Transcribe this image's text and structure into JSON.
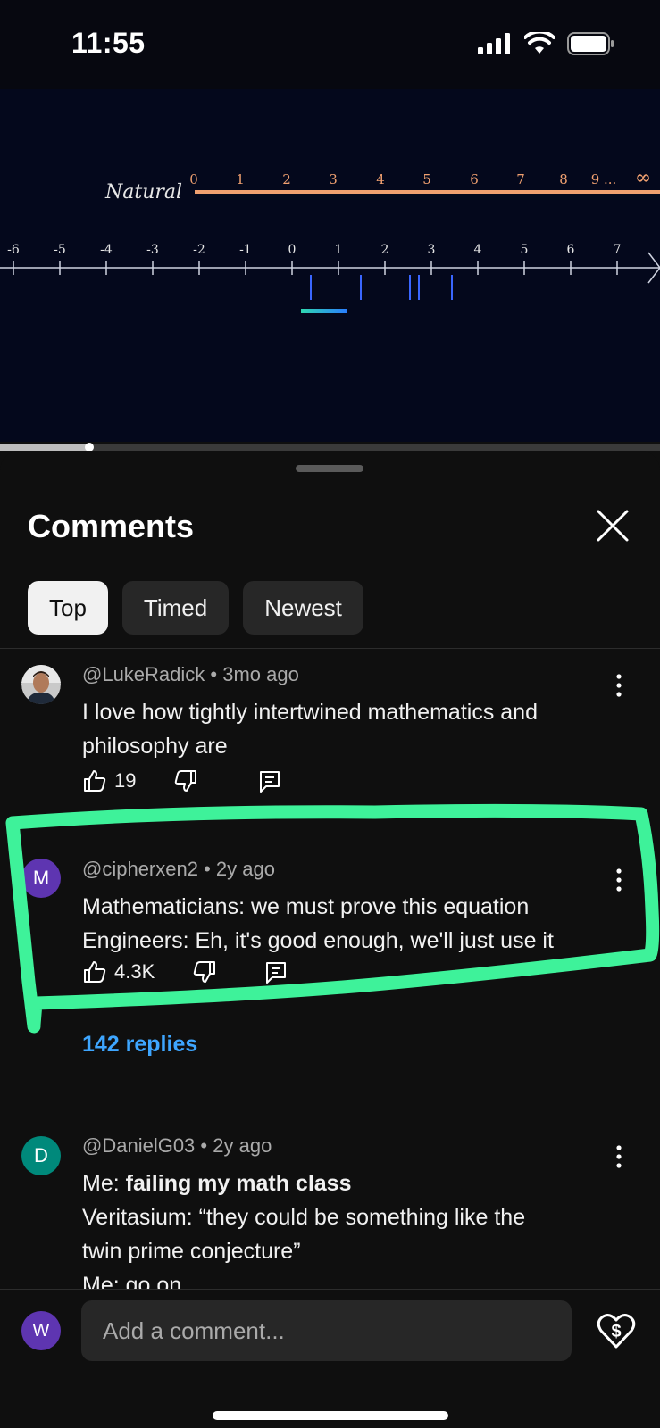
{
  "status_bar": {
    "time": "11:55",
    "icons": [
      "cellular-signal-icon",
      "wifi-icon",
      "battery-icon"
    ]
  },
  "video": {
    "natural_label": "Natural",
    "natural_ticks": [
      "0",
      "1",
      "2",
      "3",
      "4",
      "5",
      "6",
      "7",
      "8",
      "9 ...",
      "∞"
    ],
    "number_line_ticks": [
      "-6",
      "-5",
      "-4",
      "-3",
      "-2",
      "-1",
      "0",
      "1",
      "2",
      "3",
      "4",
      "5",
      "6",
      "7"
    ],
    "accent_orange": "#f0a070",
    "line_color": "#cfd3e0"
  },
  "sheet": {
    "title": "Comments",
    "close_icon": "close-icon",
    "chips": [
      "Top",
      "Timed",
      "Newest"
    ],
    "active_chip": "Top"
  },
  "comments": [
    {
      "author": "@LukeRadick",
      "age": "3mo ago",
      "text": "I love how tightly intertwined mathematics and philosophy are",
      "likes": "19",
      "avatar_color": "#d8d8d8"
    },
    {
      "author": "@cipherxen2",
      "age": "2y ago",
      "line1": "Mathematicians: we must prove this equation",
      "line2": "Engineers: Eh, it's good enough, we'll just use it",
      "likes": "4.3K",
      "avatar_letter": "M",
      "avatar_color": "#5e35b1",
      "replies": "142 replies"
    },
    {
      "author": "@DanielG03",
      "age": "2y ago",
      "line1_prefix": "Me: ",
      "line1_bold": "failing my math class",
      "line2": "Veritasium: “they could be something like the",
      "line3": "twin prime conjecture”",
      "line4": "Me: go on...",
      "avatar_letter": "D",
      "avatar_color": "#00897b"
    }
  ],
  "composer": {
    "avatar_letter": "W",
    "avatar_color": "#5e35b1",
    "placeholder": "Add a comment...",
    "thanks_icon": "super-thanks-icon"
  },
  "highlight_color": "#3ef29a"
}
